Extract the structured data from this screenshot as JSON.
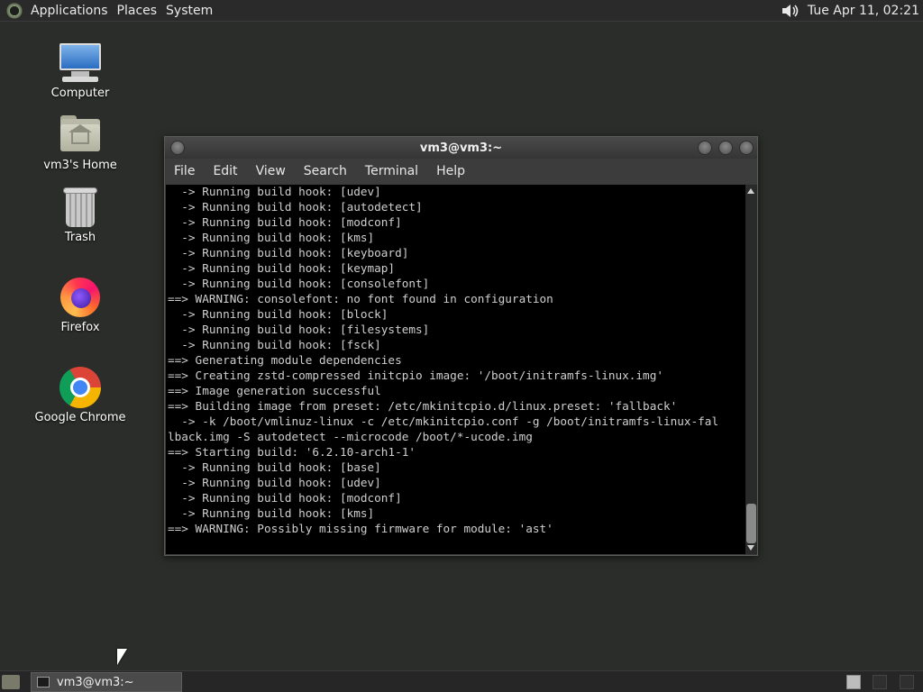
{
  "top_panel": {
    "menus": [
      "Applications",
      "Places",
      "System"
    ],
    "clock": "Tue Apr 11, 02:21"
  },
  "desktop_icons": [
    {
      "label": "Computer",
      "icon": "computer-icon"
    },
    {
      "label": "vm3's Home",
      "icon": "home-folder-icon"
    },
    {
      "label": "Trash",
      "icon": "trash-icon"
    },
    {
      "label": "Firefox",
      "icon": "firefox-icon"
    },
    {
      "label": "Google Chrome",
      "icon": "chrome-icon"
    }
  ],
  "terminal": {
    "title": "vm3@vm3:~",
    "menu": [
      "File",
      "Edit",
      "View",
      "Search",
      "Terminal",
      "Help"
    ],
    "lines": [
      "  -> Running build hook: [udev]",
      "  -> Running build hook: [autodetect]",
      "  -> Running build hook: [modconf]",
      "  -> Running build hook: [kms]",
      "  -> Running build hook: [keyboard]",
      "  -> Running build hook: [keymap]",
      "  -> Running build hook: [consolefont]",
      "==> WARNING: consolefont: no font found in configuration",
      "  -> Running build hook: [block]",
      "  -> Running build hook: [filesystems]",
      "  -> Running build hook: [fsck]",
      "==> Generating module dependencies",
      "==> Creating zstd-compressed initcpio image: '/boot/initramfs-linux.img'",
      "==> Image generation successful",
      "==> Building image from preset: /etc/mkinitcpio.d/linux.preset: 'fallback'",
      "  -> -k /boot/vmlinuz-linux -c /etc/mkinitcpio.conf -g /boot/initramfs-linux-fal",
      "lback.img -S autodetect --microcode /boot/*-ucode.img",
      "==> Starting build: '6.2.10-arch1-1'",
      "  -> Running build hook: [base]",
      "  -> Running build hook: [udev]",
      "  -> Running build hook: [modconf]",
      "  -> Running build hook: [kms]",
      "==> WARNING: Possibly missing firmware for module: 'ast'"
    ]
  },
  "taskbar": {
    "task_label": "vm3@vm3:~"
  }
}
